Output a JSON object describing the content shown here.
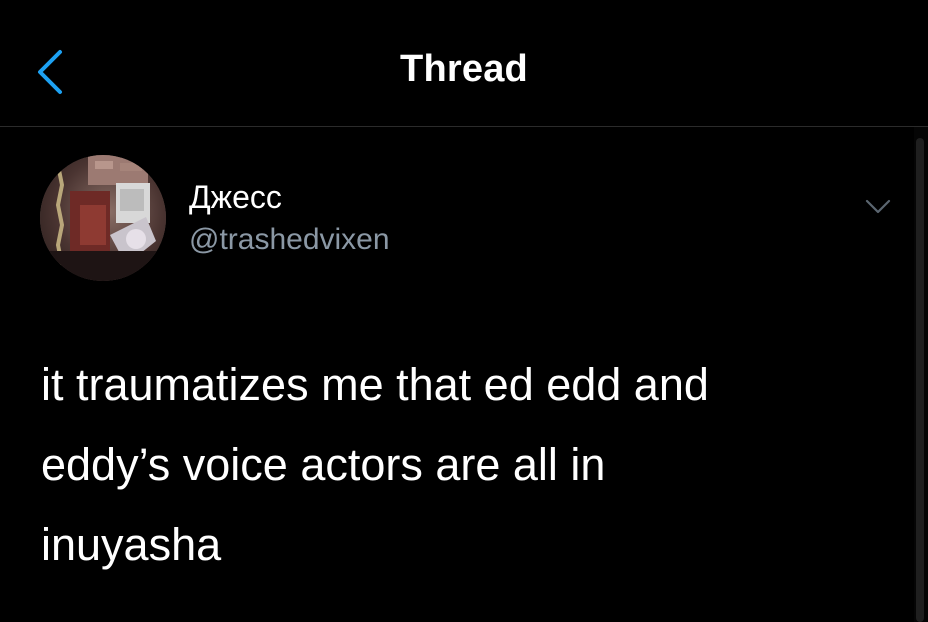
{
  "header": {
    "title": "Thread",
    "back_icon": "chevron-left-icon"
  },
  "tweet": {
    "display_name": "Джесс",
    "handle": "@trashedvixen",
    "text": "it traumatizes me that ed edd and\neddy’s voice actors are all in\ninuyasha",
    "more_icon": "chevron-down-icon",
    "avatar": "user-avatar"
  },
  "colors": {
    "background": "#000000",
    "accent": "#1da1f2",
    "secondary_text": "#8b98a5",
    "divider": "#2b2b2b"
  }
}
